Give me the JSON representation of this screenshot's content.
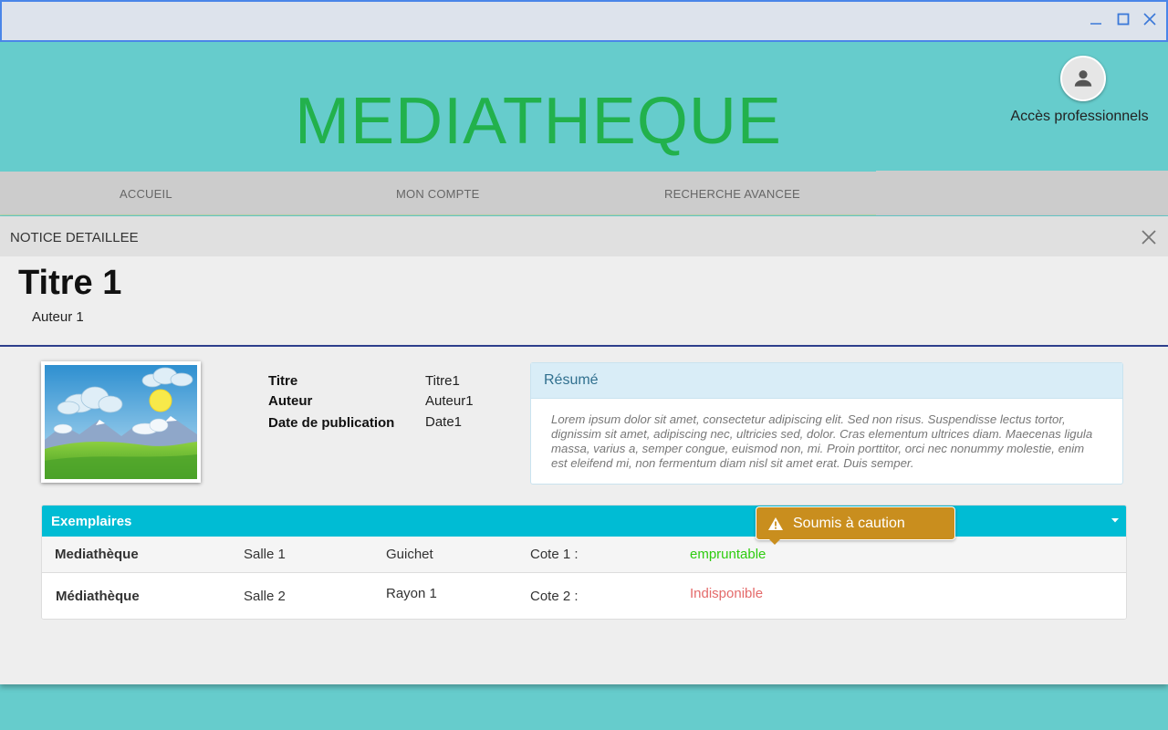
{
  "app": {
    "title": "MEDIATHEQUE",
    "professional_access_label": "Accès professionnels"
  },
  "window_controls": [
    "minimize-icon",
    "maximize-icon",
    "close-icon"
  ],
  "nav": {
    "items": [
      {
        "label": "ACCUEIL"
      },
      {
        "label": "MON COMPTE"
      },
      {
        "label": "RECHERCHE AVANCEE"
      }
    ]
  },
  "notice": {
    "header": "NOTICE DETAILLEE",
    "title": "Titre 1",
    "author": "Auteur 1",
    "cover_icon": "landscape-image",
    "fields": [
      {
        "label": "Titre",
        "value": "Titre1"
      },
      {
        "label": "Auteur",
        "value": "Auteur1"
      },
      {
        "label": "Date de publication",
        "value": "Date1"
      }
    ],
    "resume": {
      "title": "Résumé",
      "text": "Lorem ipsum dolor sit amet, consectetur adipiscing elit. Sed non risus. Suspendisse lectus tortor, dignissim sit amet, adipiscing nec, ultricies sed, dolor. Cras elementum ultrices diam. Maecenas ligula massa, varius a, semper congue, euismod non, mi. Proin porttitor, orci nec nonummy molestie, enim est eleifend mi, non fermentum diam nisl sit amet erat. Duis semper."
    }
  },
  "exemplaires": {
    "title": "Exemplaires",
    "rows": [
      {
        "library": "Mediathèque",
        "room": "Salle 1",
        "location": "Guichet",
        "cote": "Cote 1 :",
        "status": "empruntable"
      },
      {
        "library": "Médiathèque",
        "room": "Salle 2",
        "location": "Rayon 1",
        "cote": "Cote 2 :",
        "status": "Indisponible"
      }
    ]
  },
  "tooltip": {
    "text": "Soumis à caution",
    "icon": "warning-icon"
  },
  "colors": {
    "brand_teal": "#66cccc",
    "title_green": "#22b14c",
    "exemplaires_header": "#00bcd4",
    "available_green": "#2ecc0f",
    "unavailable_red": "#e46a6a",
    "tooltip_amber": "#c98e1e"
  }
}
